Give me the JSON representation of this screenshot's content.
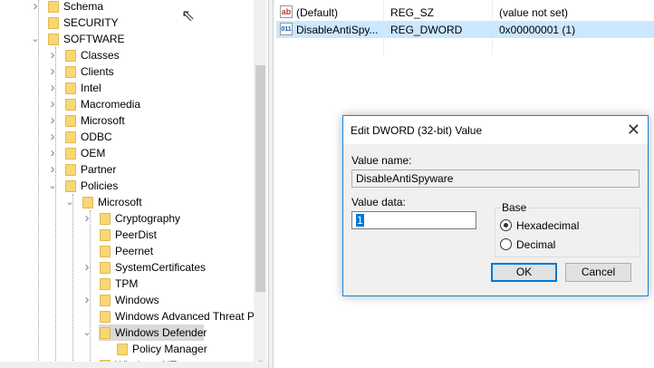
{
  "tree": [
    {
      "label": "Schema",
      "level": 0,
      "chev": "right"
    },
    {
      "label": "SECURITY",
      "level": 0,
      "chev": "none"
    },
    {
      "label": "SOFTWARE",
      "level": 0,
      "chev": "down"
    },
    {
      "label": "Classes",
      "level": 1,
      "chev": "right"
    },
    {
      "label": "Clients",
      "level": 1,
      "chev": "right"
    },
    {
      "label": "Intel",
      "level": 1,
      "chev": "right"
    },
    {
      "label": "Macromedia",
      "level": 1,
      "chev": "right"
    },
    {
      "label": "Microsoft",
      "level": 1,
      "chev": "right"
    },
    {
      "label": "ODBC",
      "level": 1,
      "chev": "right"
    },
    {
      "label": "OEM",
      "level": 1,
      "chev": "right"
    },
    {
      "label": "Partner",
      "level": 1,
      "chev": "right"
    },
    {
      "label": "Policies",
      "level": 1,
      "chev": "down"
    },
    {
      "label": "Microsoft",
      "level": 2,
      "chev": "down"
    },
    {
      "label": "Cryptography",
      "level": 3,
      "chev": "right"
    },
    {
      "label": "PeerDist",
      "level": 3,
      "chev": "none"
    },
    {
      "label": "Peernet",
      "level": 3,
      "chev": "none"
    },
    {
      "label": "SystemCertificates",
      "level": 3,
      "chev": "right"
    },
    {
      "label": "TPM",
      "level": 3,
      "chev": "none"
    },
    {
      "label": "Windows",
      "level": 3,
      "chev": "right"
    },
    {
      "label": "Windows Advanced Threat P",
      "level": 3,
      "chev": "none"
    },
    {
      "label": "Windows Defender",
      "level": 3,
      "chev": "down",
      "selected": true
    },
    {
      "label": "Policy Manager",
      "level": 4,
      "chev": "none"
    },
    {
      "label": "Windows NT",
      "level": 3,
      "chev": "right"
    }
  ],
  "values": [
    {
      "icon": "ab",
      "name": "(Default)",
      "type": "REG_SZ",
      "data": "(value not set)"
    },
    {
      "icon": "011",
      "name": "DisableAntiSpy...",
      "type": "REG_DWORD",
      "data": "0x00000001 (1)"
    }
  ],
  "dialog": {
    "title": "Edit DWORD (32-bit) Value",
    "close": "✕",
    "value_name_label": "Value name:",
    "value_name": "DisableAntiSpyware",
    "value_data_label": "Value data:",
    "value_data": "1",
    "base_label": "Base",
    "hex_label": "Hexadecimal",
    "dec_label": "Decimal",
    "ok": "OK",
    "cancel": "Cancel"
  }
}
